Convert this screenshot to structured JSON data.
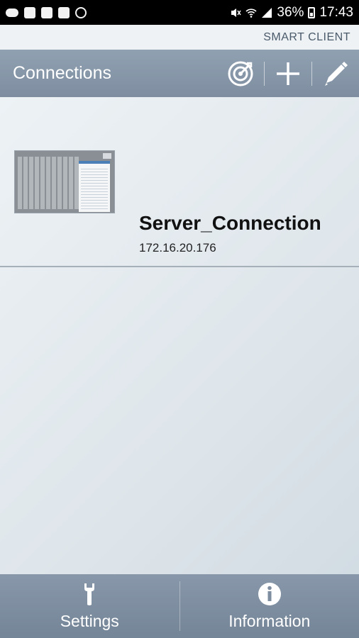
{
  "status_bar": {
    "battery": "36%",
    "time": "17:43"
  },
  "brand": "SMART CLIENT",
  "action_bar": {
    "title": "Connections",
    "icons": [
      "target-icon",
      "add-icon",
      "edit-icon"
    ]
  },
  "connections": [
    {
      "name": "Server_Connection",
      "ip": "172.16.20.176"
    }
  ],
  "bottom_bar": {
    "settings_label": "Settings",
    "information_label": "Information"
  },
  "colors": {
    "action_bar": "#8595a7",
    "bottom_bar": "#7e8ea0",
    "text_primary": "#111111"
  }
}
